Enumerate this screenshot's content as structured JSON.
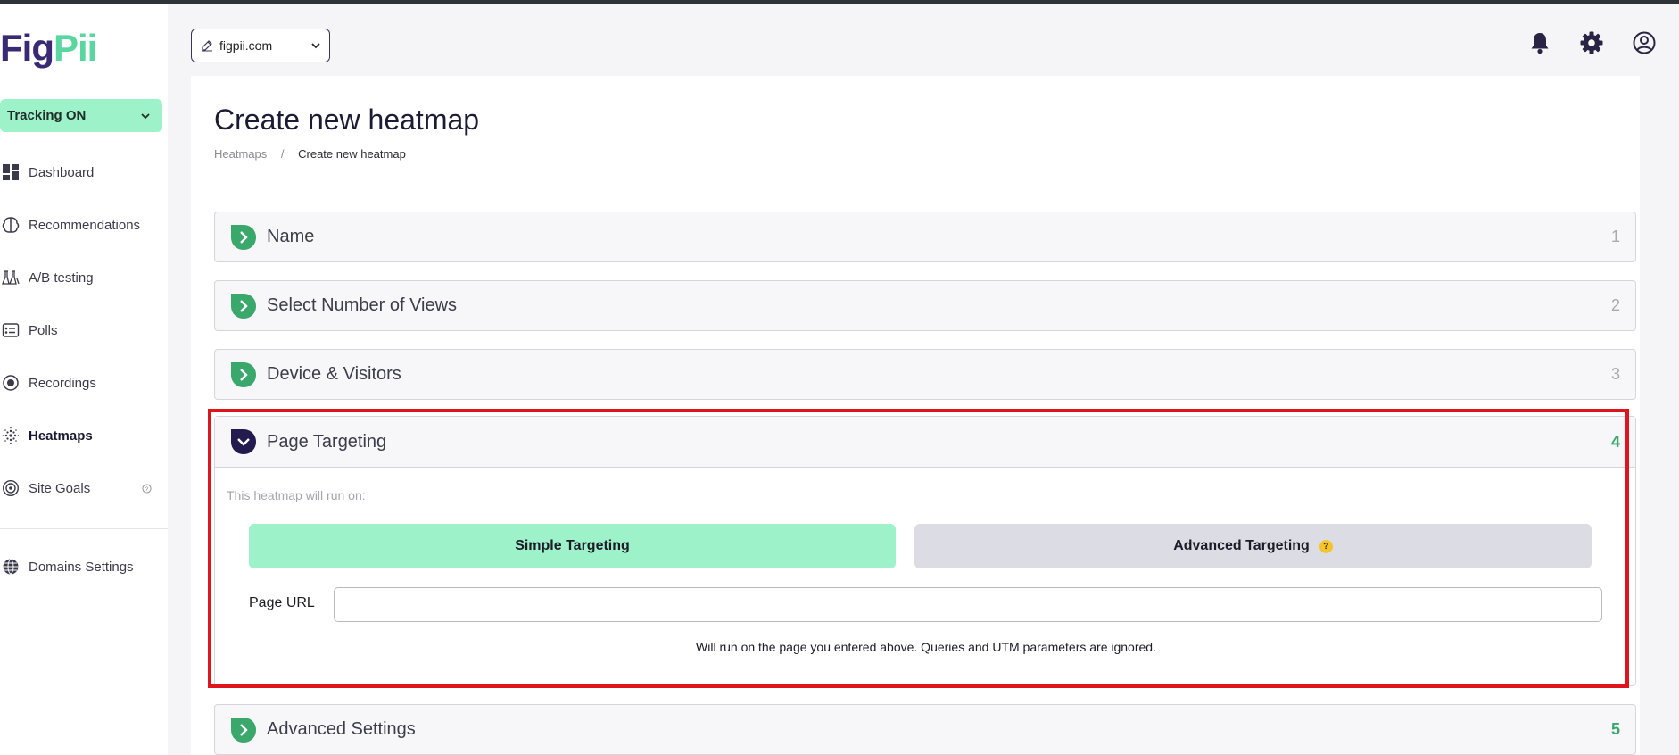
{
  "app": {
    "logo": {
      "part1": "Fig",
      "part2": "Pii"
    },
    "tracking_label": "Tracking ON"
  },
  "sidebar": {
    "items": [
      {
        "label": "Dashboard",
        "icon": "dashboard-icon"
      },
      {
        "label": "Recommendations",
        "icon": "brain-icon"
      },
      {
        "label": "A/B testing",
        "icon": "flask-icon"
      },
      {
        "label": "Polls",
        "icon": "poll-icon"
      },
      {
        "label": "Recordings",
        "icon": "record-icon"
      },
      {
        "label": "Heatmaps",
        "icon": "heatmap-icon",
        "active": true
      },
      {
        "label": "Site Goals",
        "icon": "target-icon"
      },
      {
        "label": "Domains Settings",
        "icon": "globe-icon"
      }
    ]
  },
  "header": {
    "domain_value": "figpii.com"
  },
  "page": {
    "title": "Create new heatmap",
    "breadcrumb": {
      "parent": "Heatmaps",
      "separator": "/",
      "current": "Create new heatmap"
    }
  },
  "steps": [
    {
      "title": "Name",
      "number": "1"
    },
    {
      "title": "Select Number of Views",
      "number": "2"
    },
    {
      "title": "Device & Visitors",
      "number": "3"
    },
    {
      "title": "Page Targeting",
      "number": "4"
    },
    {
      "title": "Advanced Settings",
      "number": "5"
    }
  ],
  "targeting": {
    "runs_on_label": "This heatmap will run on:",
    "simple_label": "Simple Targeting",
    "advanced_label": "Advanced Targeting",
    "help_badge": "?",
    "url_label": "Page URL",
    "url_value": "",
    "url_help": "Will run on the page you entered above. Queries and UTM parameters are ignored."
  },
  "colors": {
    "brand_dark": "#3a2a73",
    "brand_green": "#5cd6a0",
    "tracking_bg": "#9ef2c9",
    "step_check": "#3aa86b",
    "highlight": "#e0141c"
  }
}
